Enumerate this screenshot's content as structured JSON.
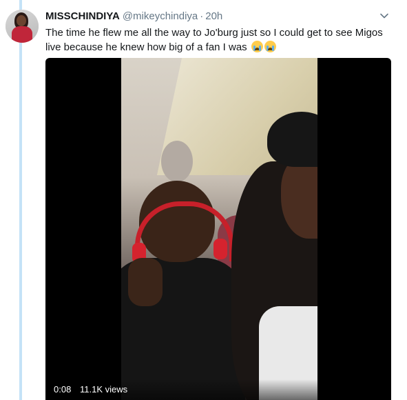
{
  "tweet": {
    "display_name": "MISSCHINDIYA",
    "handle": "@mikeychindiya",
    "separator": "·",
    "timestamp": "20h",
    "text": "The time he flew me all the way to Jo'burg just so I could get to see Migos live because he knew how big of a fan I was",
    "emoji": [
      "loudly-crying-face",
      "loudly-crying-face"
    ]
  },
  "video": {
    "elapsed": "0:08",
    "views": "11.1K views"
  },
  "colors": {
    "thread_line": "#c4e2f7",
    "secondary_text": "#657786",
    "primary_text": "#14171a"
  }
}
